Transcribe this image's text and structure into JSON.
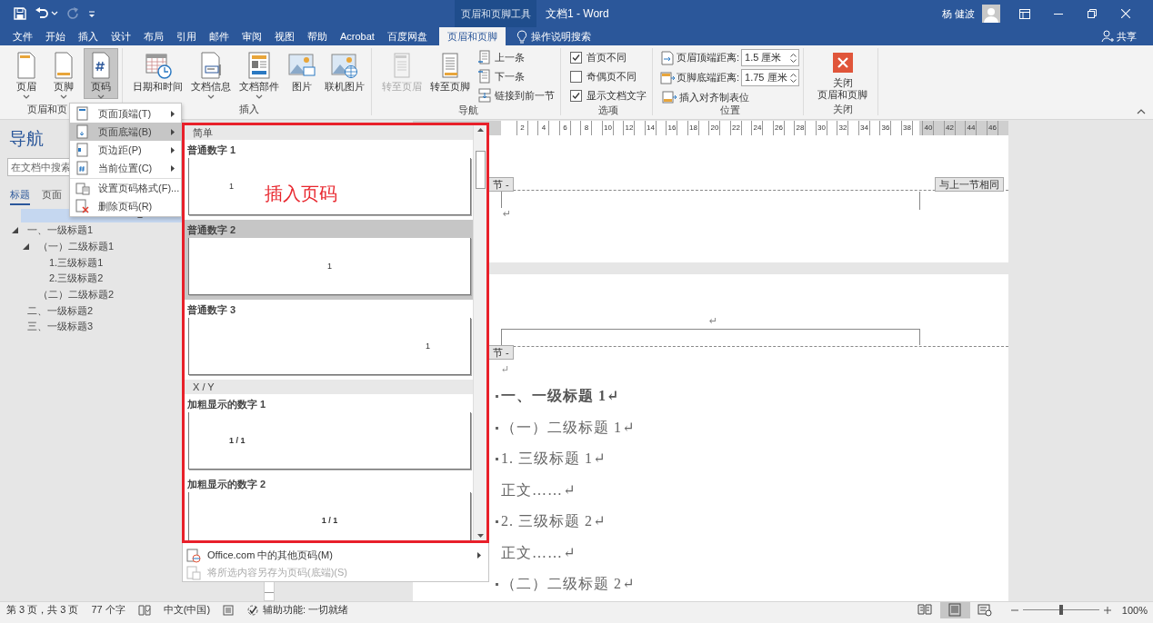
{
  "title_bar": {
    "tool_group": "页眉和页脚工具",
    "document_title": "文档1 - Word",
    "user_name": "杨 健波"
  },
  "ribbon_tabs": [
    {
      "label": "文件",
      "selected": false
    },
    {
      "label": "开始",
      "selected": false
    },
    {
      "label": "插入",
      "selected": false
    },
    {
      "label": "设计",
      "selected": false
    },
    {
      "label": "布局",
      "selected": false
    },
    {
      "label": "引用",
      "selected": false
    },
    {
      "label": "邮件",
      "selected": false
    },
    {
      "label": "审阅",
      "selected": false
    },
    {
      "label": "视图",
      "selected": false
    },
    {
      "label": "帮助",
      "selected": false
    },
    {
      "label": "Acrobat",
      "selected": false
    },
    {
      "label": "百度网盘",
      "selected": false
    },
    {
      "label": "页眉和页脚",
      "selected": true
    }
  ],
  "tell_me": "操作说明搜索",
  "share": "共享",
  "ribbon": {
    "groups": [
      {
        "label": "页眉和页",
        "columns": [
          [
            {
              "kind": "large",
              "label": "页眉",
              "dropdown": true,
              "pressed": false,
              "disabled": false
            }
          ],
          [
            {
              "kind": "large",
              "label": "页脚",
              "dropdown": true,
              "pressed": false,
              "disabled": false
            }
          ],
          [
            {
              "kind": "large",
              "label": "页码",
              "dropdown": true,
              "pressed": true,
              "disabled": false
            }
          ]
        ]
      },
      {
        "label": "插入",
        "columns": [
          [
            {
              "kind": "large",
              "label": "日期和时间",
              "dropdown": false,
              "pressed": false,
              "disabled": false
            }
          ],
          [
            {
              "kind": "large",
              "label": "文档信息",
              "dropdown": true,
              "pressed": false,
              "disabled": false
            }
          ],
          [
            {
              "kind": "large",
              "label": "文档部件",
              "dropdown": true,
              "pressed": false,
              "disabled": false
            }
          ],
          [
            {
              "kind": "large",
              "label": "图片",
              "dropdown": false,
              "pressed": false,
              "disabled": false
            }
          ],
          [
            {
              "kind": "large",
              "label": "联机图片",
              "dropdown": false,
              "pressed": false,
              "disabled": false
            }
          ]
        ]
      },
      {
        "label": "导航",
        "columns": [
          [
            {
              "kind": "large",
              "label": "转至页眉",
              "dropdown": false,
              "pressed": false,
              "disabled": true
            }
          ],
          [
            {
              "kind": "large",
              "label": "转至页脚",
              "dropdown": false,
              "pressed": false,
              "disabled": false
            }
          ],
          [
            {
              "kind": "small",
              "label": "上一条"
            },
            {
              "kind": "small",
              "label": "下一条"
            },
            {
              "kind": "small",
              "label": "链接到前一节"
            }
          ]
        ]
      },
      {
        "label": "选项",
        "columns": [
          [
            {
              "kind": "checkbox",
              "label": "首页不同",
              "checked": true
            },
            {
              "kind": "checkbox",
              "label": "奇偶页不同",
              "checked": false
            },
            {
              "kind": "checkbox",
              "label": "显示文档文字",
              "checked": true
            }
          ]
        ]
      },
      {
        "label": "位置",
        "columns": [
          [
            {
              "kind": "spin",
              "label": "页眉顶端距离:",
              "value": "1.5 厘米"
            },
            {
              "kind": "spin",
              "label": "页脚底端距离:",
              "value": "1.75 厘米"
            },
            {
              "kind": "small",
              "label": "插入对齐制表位"
            }
          ]
        ]
      },
      {
        "label": "关闭",
        "columns": [
          [
            {
              "kind": "close",
              "lines": [
                "关闭",
                "页眉和页脚"
              ]
            }
          ]
        ]
      }
    ]
  },
  "navigation": {
    "title": "导航",
    "search": {
      "placeholder": "在文档中搜索"
    },
    "tabs": [
      {
        "label": "标题",
        "selected": true
      },
      {
        "label": "页面",
        "selected": false
      }
    ],
    "headings": [
      {
        "label": "一、一级标题1",
        "expanded": true,
        "children": [
          {
            "label": "（一）二级标题1",
            "expanded": true,
            "children": [
              {
                "label": "1.三级标题1"
              },
              {
                "label": "2.三级标题2"
              }
            ]
          },
          {
            "label": "（二）二级标题2"
          }
        ]
      },
      {
        "label": "二、一级标题2"
      },
      {
        "label": "三、一级标题3"
      }
    ]
  },
  "document": {
    "ruler_labels": [
      "2",
      "4",
      "6",
      "8",
      "10",
      "12",
      "14",
      "16",
      "18",
      "20",
      "22",
      "24",
      "26",
      "28",
      "30",
      "32",
      "34",
      "36",
      "38",
      "40",
      "42",
      "44",
      "46"
    ],
    "page_1": {
      "footer_tag": "节 -",
      "same_as_previous": "与上一节相同",
      "paragraph_mark": "↵"
    },
    "page_2": {
      "header_mark": "↵",
      "header_tag": "节 -",
      "paragraphs": [
        {
          "kind": "empty",
          "text": "↵"
        },
        {
          "kind": "heading1",
          "text": "一、一级标题 1↵"
        },
        {
          "kind": "heading2",
          "text": "（一）二级标题 1↵"
        },
        {
          "kind": "heading3",
          "text": "1. 三级标题 1↵"
        },
        {
          "kind": "body",
          "text": "正文……↵"
        },
        {
          "kind": "heading3",
          "text": "2. 三级标题 2↵"
        },
        {
          "kind": "body",
          "text": "正文……↵"
        },
        {
          "kind": "heading2",
          "text": "（二）二级标题 2↵"
        }
      ]
    }
  },
  "page_number_menu": {
    "items": [
      {
        "label": "页面顶端(T)",
        "submenu": true,
        "selected": false
      },
      {
        "label": "页面底端(B)",
        "submenu": true,
        "selected": true
      },
      {
        "label": "页边距(P)",
        "submenu": true,
        "selected": false
      },
      {
        "label": "当前位置(C)",
        "submenu": true,
        "selected": false
      },
      {
        "label": "设置页码格式(F)...",
        "submenu": false,
        "selected": false
      },
      {
        "label": "删除页码(R)",
        "submenu": false,
        "selected": false
      }
    ]
  },
  "gallery": {
    "sections": [
      {
        "heading": "简单",
        "items": [
          {
            "label": "普通数字 1",
            "sample": "1",
            "kind": "left",
            "selected": false
          },
          {
            "label": "普通数字 2",
            "sample": "1",
            "kind": "center",
            "selected": true
          },
          {
            "label": "普通数字 3",
            "sample": "1",
            "kind": "right",
            "selected": false
          }
        ]
      },
      {
        "heading": "X / Y",
        "items": [
          {
            "label": "加粗显示的数字 1",
            "sample": "1 / 1",
            "kind": "left",
            "selected": false
          },
          {
            "label": "加粗显示的数字 2",
            "sample": "1 / 1",
            "kind": "center",
            "selected": false
          }
        ]
      }
    ],
    "annotation": "插入页码",
    "more": [
      {
        "label": "Office.com 中的其他页码(M)",
        "submenu": true,
        "disabled": false
      },
      {
        "label": "将所选内容另存为页码(底端)(S)",
        "submenu": false,
        "disabled": true
      }
    ]
  },
  "status_bar": {
    "page": "第 3 页，共 3 页",
    "words": "77 个字",
    "language": "中文(中国)",
    "accessibility": "辅助功能: 一切就绪",
    "views": [
      {
        "kind": "read",
        "selected": false
      },
      {
        "kind": "print",
        "selected": true
      },
      {
        "kind": "web",
        "selected": false
      }
    ],
    "zoom": {
      "level": 0.5
    },
    "zoom_text": "100%"
  }
}
